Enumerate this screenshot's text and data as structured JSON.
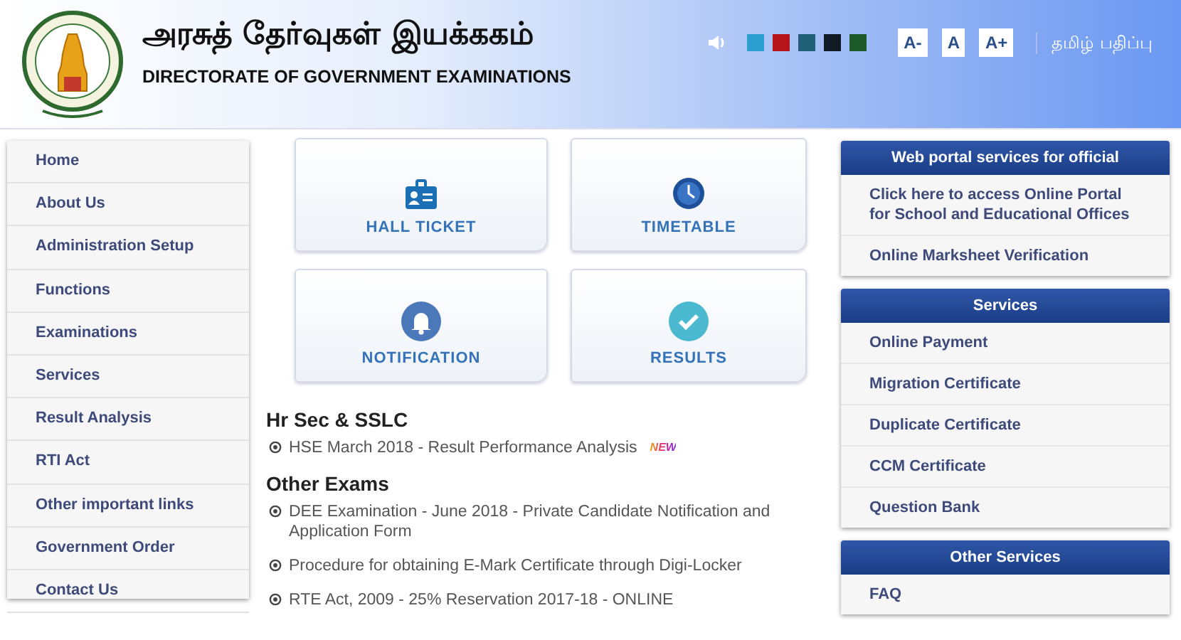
{
  "header": {
    "title_tamil": "அரசுத் தேர்வுகள் இயக்ககம்",
    "title": "DIRECTORATE OF GOVERNMENT EXAMINATIONS",
    "color_themes": [
      {
        "color": "#2a9fd0"
      },
      {
        "color": "#b5141b"
      },
      {
        "color": "#1f5f78"
      },
      {
        "color": "#0f1a24"
      },
      {
        "color": "#1d5c2a"
      }
    ],
    "font_buttons": [
      "A-",
      "A",
      "A+"
    ],
    "language_link": "தமிழ் பதிப்பு"
  },
  "sidebar": {
    "items": [
      "Home",
      "About Us",
      "Administration Setup",
      "Functions",
      "Examinations",
      "Services",
      "Result Analysis",
      "RTI Act",
      "Other important links",
      "Government Order",
      "Contact Us"
    ]
  },
  "tiles": [
    {
      "kind": "ticket",
      "label": "HALL TICKET"
    },
    {
      "kind": "clock",
      "label": "TIMETABLE"
    },
    {
      "kind": "bell",
      "label": "NOTIFICATION"
    },
    {
      "kind": "check",
      "label": "RESULTS"
    }
  ],
  "news": [
    {
      "heading": "Hr Sec & SSLC",
      "items": [
        {
          "text": "HSE March 2018 - Result Performance Analysis",
          "badge": "NEW"
        }
      ]
    },
    {
      "heading": "Other Exams",
      "items": [
        {
          "text": "DEE Examination - June 2018 - Private Candidate Notification and Application Form"
        },
        {
          "text": "Procedure for obtaining E-Mark Certificate through Digi-Locker"
        },
        {
          "text": "RTE Act, 2009 - 25% Reservation 2017-18 - ONLINE"
        }
      ]
    }
  ],
  "panels": [
    {
      "title": "Web portal services for official",
      "items": [
        "Click here to access Online Portal for School and Educational Offices",
        "Online Marksheet Verification"
      ]
    },
    {
      "title": "Services",
      "items": [
        "Online Payment",
        "Migration Certificate",
        "Duplicate Certificate",
        "CCM Certificate",
        "Question Bank"
      ]
    },
    {
      "title": "Other Services",
      "items": [
        "FAQ"
      ]
    }
  ]
}
